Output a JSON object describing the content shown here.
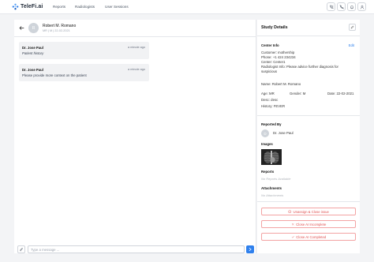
{
  "app": {
    "name": "TeleFi.ai"
  },
  "nav": {
    "items": [
      "Reports",
      "Radiologists",
      "User Sessions"
    ]
  },
  "chat": {
    "patient_name": "Robert M. Romano",
    "patient_initial": "R",
    "patient_meta": "MR | M | 22-02-2021",
    "messages": [
      {
        "author": "Dr. Jose Paul",
        "time": "a minute ago",
        "text": "Patient history"
      },
      {
        "author": "Dr. Jose Paul",
        "time": "a minute ago",
        "text": "Please provide more context on the patient"
      }
    ],
    "input_placeholder": "Type a message ..."
  },
  "study": {
    "title": "Study Details",
    "center_info": {
      "heading": "Center Info",
      "edit_label": "Edit",
      "customer": "Customer: mothership",
      "phone": "Phone: +1 424 234234",
      "center": "Center: Center1",
      "radiologist_info": "Radiologist Info: Please advice further diagnosis for suspicious"
    },
    "patient": {
      "name": "Name: Robert M. Romano",
      "age": "Age: MR",
      "gender": "Gender: M",
      "date": "Date: 22-02-2021",
      "desc": "Desc: desc",
      "history": "History: FEVER"
    },
    "reported_by": {
      "heading": "Reported By",
      "initial": "D",
      "name": "Dr. Jose Paul"
    },
    "images": {
      "heading": "Images"
    },
    "reports": {
      "heading": "Reports",
      "empty": "No Reports Available"
    },
    "attachments": {
      "heading": "Attachments",
      "empty": "No Attachments"
    },
    "actions": [
      {
        "label": "Unassign & Close issue",
        "icon": "unassign-icon"
      },
      {
        "label": "Close AI Incomplete",
        "icon": "close-icon"
      },
      {
        "label": "Close AI Completed",
        "icon": "check-icon"
      }
    ]
  },
  "colors": {
    "accent": "#2f80ed",
    "danger": "#e05252",
    "danger_border": "#f3a3a3",
    "background": "#f3f4f6"
  }
}
